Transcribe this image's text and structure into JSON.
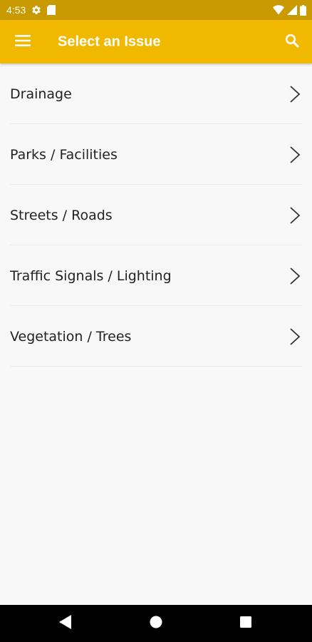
{
  "status_bar": {
    "time": "4:53",
    "icons": [
      "settings-icon",
      "sd-card-icon",
      "wifi-icon",
      "signal-icon",
      "battery-icon"
    ]
  },
  "app_bar": {
    "title": "Select an Issue",
    "menu_icon": "hamburger-menu-icon",
    "search_icon": "search-icon",
    "background_color": "#f1b800",
    "status_bar_color": "#c89a00"
  },
  "issues": [
    {
      "label": "Drainage"
    },
    {
      "label": "Parks / Facilities"
    },
    {
      "label": "Streets / Roads"
    },
    {
      "label": "Traffic Signals / Lighting"
    },
    {
      "label": "Vegetation / Trees"
    }
  ],
  "nav_bar": {
    "icons": [
      "back-icon",
      "home-icon",
      "recents-icon"
    ]
  }
}
